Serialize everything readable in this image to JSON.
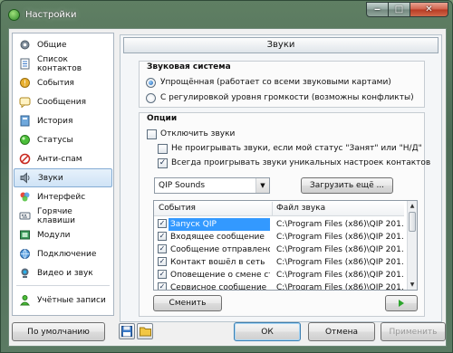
{
  "window": {
    "title": "Настройки",
    "buttons": {
      "minimize": "‒",
      "maximize": "□",
      "close": "✕"
    }
  },
  "sidebar": {
    "items": [
      {
        "label": "Общие",
        "icon": "gear-icon",
        "active": false
      },
      {
        "label": "Список контактов",
        "icon": "contacts-icon",
        "active": false
      },
      {
        "label": "События",
        "icon": "events-icon",
        "active": false
      },
      {
        "label": "Сообщения",
        "icon": "messages-icon",
        "active": false
      },
      {
        "label": "История",
        "icon": "history-icon",
        "active": false
      },
      {
        "label": "Статусы",
        "icon": "status-icon",
        "active": false
      },
      {
        "label": "Анти-спам",
        "icon": "antispam-icon",
        "active": false
      },
      {
        "label": "Звуки",
        "icon": "speaker-icon",
        "active": true
      },
      {
        "label": "Интерфейс",
        "icon": "interface-icon",
        "active": false
      },
      {
        "label": "Горячие клавиши",
        "icon": "hotkeys-icon",
        "active": false
      },
      {
        "label": "Модули",
        "icon": "modules-icon",
        "active": false
      },
      {
        "label": "Подключение",
        "icon": "connection-icon",
        "active": false
      },
      {
        "label": "Видео и звук",
        "icon": "video-icon",
        "active": false
      },
      {
        "label": "Учётные записи",
        "icon": "accounts-icon",
        "active": false
      }
    ]
  },
  "main": {
    "header": "Звуки",
    "sound_system": {
      "title": "Звуковая система",
      "options": [
        {
          "label": "Упрощённая (работает со всеми звуковыми картами)",
          "checked": true
        },
        {
          "label": "С регулировкой уровня громкости (возможны конфликты)",
          "checked": false
        }
      ]
    },
    "options": {
      "title": "Опции",
      "checkboxes": [
        {
          "label": "Отключить звуки",
          "checked": false
        },
        {
          "label": "Не проигрывать звуки, если мой статус \"Занят\" или \"Н/Д\"",
          "checked": false
        },
        {
          "label": "Всегда проигрывать звуки уникальных настроек контактов",
          "checked": true
        }
      ],
      "theme_select": "QIP Sounds",
      "load_more_button": "Загрузить ещё ...",
      "table": {
        "columns": [
          "События",
          "Файл звука"
        ],
        "rows": [
          {
            "event": "Запуск QIP",
            "file": "C:\\Program Files (x86)\\QIP 201...",
            "checked": true,
            "selected": true
          },
          {
            "event": "Входящее сообщение",
            "file": "C:\\Program Files (x86)\\QIP 201...",
            "checked": true,
            "selected": false
          },
          {
            "event": "Сообщение отправлено",
            "file": "C:\\Program Files (x86)\\QIP 201...",
            "checked": true,
            "selected": false
          },
          {
            "event": "Контакт вошёл в сеть",
            "file": "C:\\Program Files (x86)\\QIP 201...",
            "checked": true,
            "selected": false
          },
          {
            "event": "Оповещение о смене стат...",
            "file": "C:\\Program Files (x86)\\QIP 201...",
            "checked": true,
            "selected": false
          },
          {
            "event": "Сервисное сообщение",
            "file": "C:\\Program Files (x86)\\QIP 201...",
            "checked": true,
            "selected": false
          }
        ]
      },
      "change_button": "Сменить"
    }
  },
  "footer": {
    "default_button": "По умолчанию",
    "ok_button": "ОК",
    "cancel_button": "Отмена",
    "apply_button": "Применить"
  },
  "colors": {
    "selection": "#3399ff",
    "play_icon": "#2da52d"
  }
}
